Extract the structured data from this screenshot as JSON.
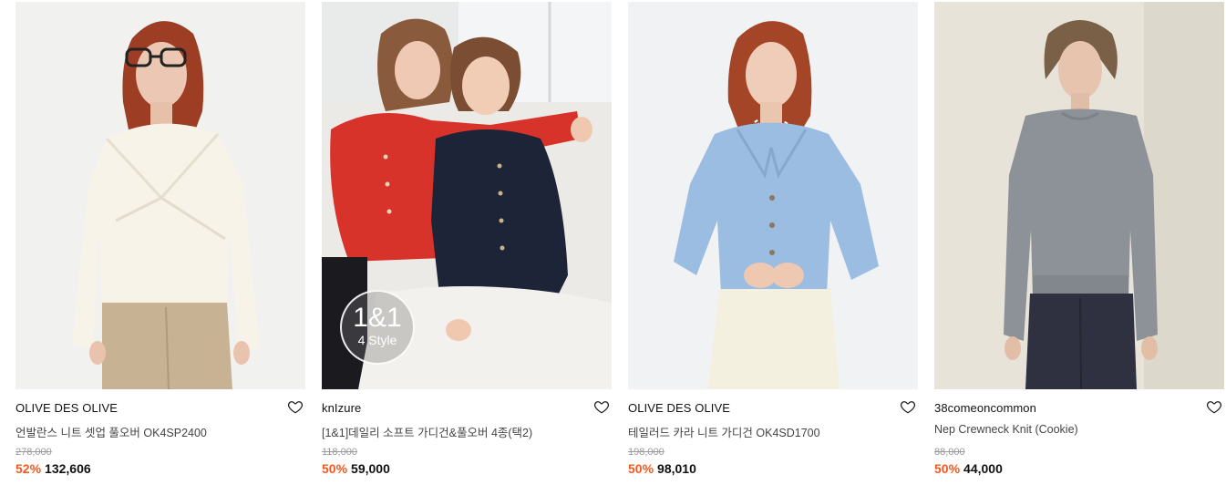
{
  "products": [
    {
      "brand": "OLIVE DES OLIVE",
      "name": "언발란스 니트 셋업 풀오버 OK4SP2400",
      "original_price": "278,000",
      "discount": "52%",
      "price": "132,606",
      "image": "model-white-knit-pullover"
    },
    {
      "brand": "knIzure",
      "name": "[1&1]데일리 소프트 가디건&풀오버 4종(택2)",
      "original_price": "118,000",
      "discount": "50%",
      "price": "59,000",
      "image": "two-models-red-navy-cardigans",
      "badge_main": "1&1",
      "badge_sub": "4 Style"
    },
    {
      "brand": "OLIVE DES OLIVE",
      "name": "테일러드 카라 니트 가디건 OK4SD1700",
      "original_price": "198,000",
      "discount": "50%",
      "price": "98,010",
      "image": "model-blue-collar-cardigan"
    },
    {
      "brand": "38comeoncommon",
      "name": "Nep Crewneck Knit (Cookie)",
      "original_price": "88,000",
      "discount": "50%",
      "price": "44,000",
      "image": "model-grey-crewneck-knit"
    }
  ],
  "colors": {
    "discount": "#f05a22",
    "price": "#111111",
    "original_price": "#9a9a9a"
  },
  "icons": {
    "wishlist": "heart-outline-icon"
  }
}
